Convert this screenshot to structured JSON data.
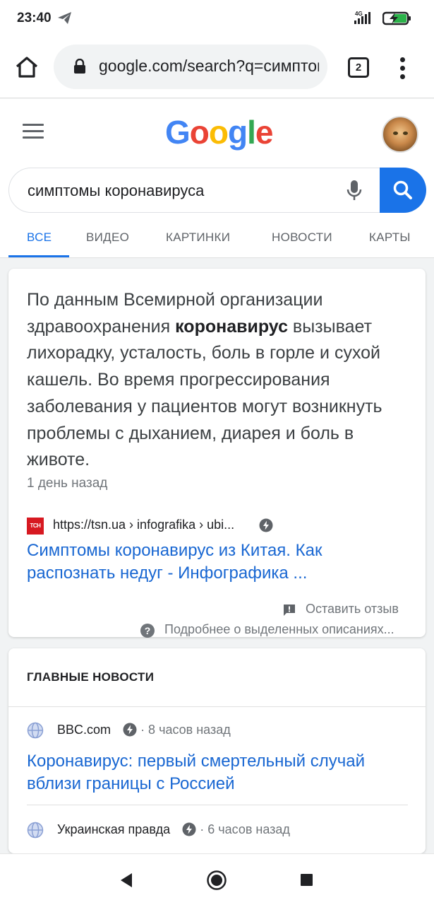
{
  "status_bar": {
    "time": "23:40",
    "network": "4G"
  },
  "browser": {
    "url": "google.com/search?q=симптомы",
    "tab_count": "2"
  },
  "google": {
    "logo": [
      "G",
      "o",
      "o",
      "g",
      "l",
      "e"
    ],
    "logo_colors": [
      "#4285F4",
      "#EA4335",
      "#FBBC05",
      "#4285F4",
      "#34A853",
      "#EA4335"
    ],
    "search_query": "симптомы коронавируса",
    "tabs": [
      {
        "label": "ВСЕ",
        "active": true
      },
      {
        "label": "ВИДЕО",
        "active": false
      },
      {
        "label": "КАРТИНКИ",
        "active": false
      },
      {
        "label": "НОВОСТИ",
        "active": false
      },
      {
        "label": "КАРТЫ",
        "active": false
      }
    ]
  },
  "featured_snippet": {
    "text_before": "По данным Всемирной организации здравоохранения ",
    "text_bold": "коронавирус",
    "text_after": " вызывает лихорадку, усталость, боль в горле и сухой кашель. Во время прогрессирования заболевания у пациентов могут возникнуть проблемы с дыханием, диарея и боль в животе.",
    "date": "1 день назад",
    "favicon_text": "ТСН",
    "source_url": "https://tsn.ua › infografika › ubi...",
    "title": "Симптомы коронавирус из Китая. Как распознать недуг - Инфографика ...",
    "feedback_label": "Оставить отзыв",
    "about_label": "Подробнее о выделенных описаниях..."
  },
  "top_news": {
    "heading": "ГЛАВНЫЕ НОВОСТИ",
    "items": [
      {
        "source": "BBC.com",
        "time": "· 8 часов назад",
        "title": "Коронавирус: первый смертельный случай вблизи границы с Россией"
      },
      {
        "source": "Украинская правда",
        "time": "· 6 часов назад",
        "title": ""
      }
    ]
  },
  "colors": {
    "accent": "#1a73e8",
    "link": "#1967d2",
    "muted": "#70757a"
  }
}
